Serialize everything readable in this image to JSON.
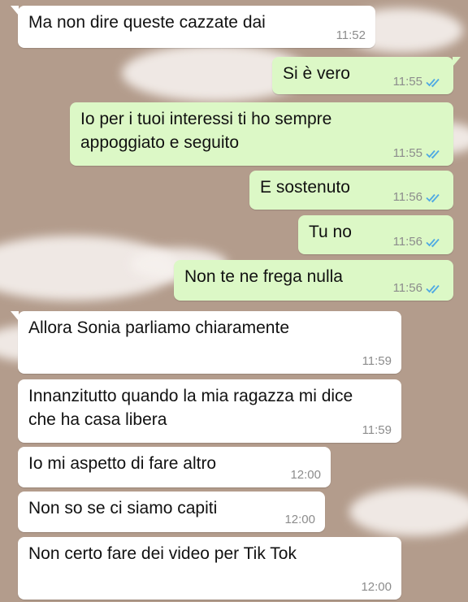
{
  "colors": {
    "incoming_bubble": "#ffffff",
    "outgoing_bubble": "#dcf8c6",
    "read_ticks": "#4fa9e3",
    "wallpaper": "#b39c8c"
  },
  "messages": [
    {
      "dir": "in",
      "text": "Ma non dire queste cazzate dai",
      "time": "11:52",
      "read": false
    },
    {
      "dir": "out",
      "text": "Si è vero",
      "time": "11:55",
      "read": true
    },
    {
      "dir": "out",
      "text": "Io per i tuoi interessi ti ho sempre\nappoggiato e seguito",
      "time": "11:55",
      "read": true
    },
    {
      "dir": "out",
      "text": "E sostenuto",
      "time": "11:56",
      "read": true
    },
    {
      "dir": "out",
      "text": "Tu no",
      "time": "11:56",
      "read": true
    },
    {
      "dir": "out",
      "text": "Non te ne frega nulla",
      "time": "11:56",
      "read": true
    },
    {
      "dir": "in",
      "text": "Allora Sonia parliamo chiaramente",
      "time": "11:59",
      "read": false
    },
    {
      "dir": "in",
      "text": "Innanzitutto quando la mia ragazza mi dice\nche ha casa libera",
      "time": "11:59",
      "read": false
    },
    {
      "dir": "in",
      "text": "Io mi aspetto di fare altro",
      "time": "12:00",
      "read": false
    },
    {
      "dir": "in",
      "text": "Non so se ci siamo capiti",
      "time": "12:00",
      "read": false
    },
    {
      "dir": "in",
      "text": "Non certo fare dei video per Tik Tok",
      "time": "12:00",
      "read": false
    }
  ]
}
